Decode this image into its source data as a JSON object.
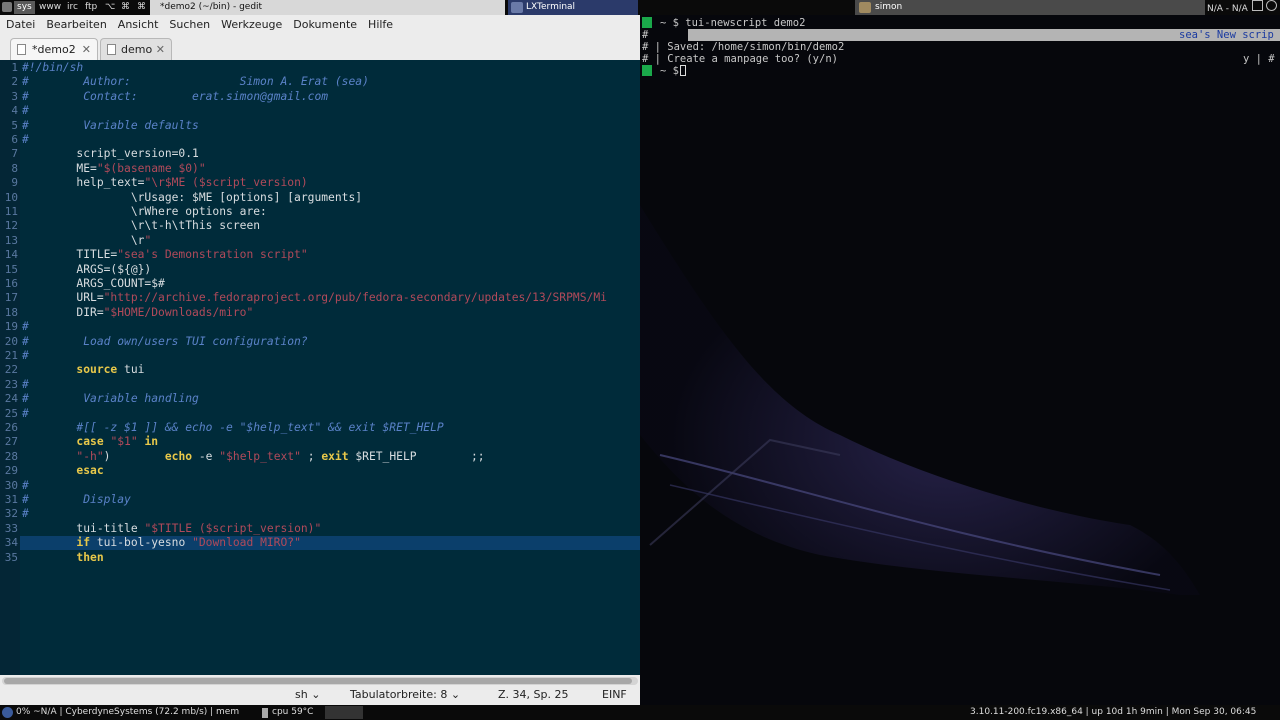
{
  "topbar": {
    "tags": [
      "sys",
      "www",
      "irc",
      "ftp",
      "⌥",
      "⌘",
      "⌘"
    ],
    "window1_title": "*demo2 (~/bin) - gedit",
    "window2_title": "LXTerminal",
    "window3_title": "simon",
    "right_status": "N/A - N/A"
  },
  "gedit": {
    "menu": [
      "Datei",
      "Bearbeiten",
      "Ansicht",
      "Suchen",
      "Werkzeuge",
      "Dokumente",
      "Hilfe"
    ],
    "tabs": [
      {
        "label": "*demo2",
        "active": true
      },
      {
        "label": "demo",
        "active": false
      }
    ],
    "line_numbers": [
      "1",
      "2",
      "3",
      "4",
      "5",
      "6",
      "7",
      "8",
      "9",
      "10",
      "11",
      "12",
      "13",
      "14",
      "15",
      "16",
      "17",
      "18",
      "19",
      "20",
      "21",
      "22",
      "23",
      "24",
      "25",
      "26",
      "27",
      "28",
      "29",
      "30",
      "31",
      "32",
      "33",
      "34",
      "35"
    ],
    "code_lines": [
      "#!/bin/sh",
      "#\tAuthor:\t\tSimon A. Erat (sea)",
      "#\tContact:\terat.simon@gmail.com",
      "#",
      "#\tVariable defaults",
      "#",
      "\tscript_version=0.1",
      "\tME=\"$(basename $0)\"",
      "\thelp_text=\"\\r$ME ($script_version)",
      "\t\t\\rUsage: $ME [options] [arguments]",
      "\t\t\\rWhere options are:",
      "\t\t\\r\\t-h\\tThis screen",
      "\t\t\\r\"",
      "\tTITLE=\"sea's Demonstration script\"",
      "\tARGS=(${@})",
      "\tARGS_COUNT=$#",
      "\tURL=\"http://archive.fedoraproject.org/pub/fedora-secondary/updates/13/SRPMS/Mi",
      "\tDIR=\"$HOME/Downloads/miro\"",
      "#",
      "#\tLoad own/users TUI configuration?",
      "#",
      "\tsource tui",
      "#",
      "#\tVariable handling",
      "#",
      "\t#[[ -z $1 ]] && echo -e \"$help_text\" && exit $RET_HELP",
      "\tcase \"$1\" in",
      "\t\"-h\")\techo -e \"$help_text\" ; exit $RET_HELP\t;;",
      "\tesac",
      "#",
      "#\tDisplay",
      "#",
      "\ttui-title \"$TITLE ($script_version)\"",
      "\tif tui-bol-yesno \"Download MIRO?\"",
      "\tthen"
    ],
    "current_line": 34,
    "status": {
      "language": "sh",
      "tab_width": "Tabulatorbreite: 8",
      "position": "Z. 34, Sp. 25",
      "mode": "EINF"
    }
  },
  "terminal": {
    "lines": [
      "~ $ tui-newscript demo2",
      "#",
      "# | Saved: /home/simon/bin/demo2",
      "# | Create a manpage too? (y/n)",
      "~ $ "
    ],
    "banner_title": "sea's New scrip",
    "prompt_answer": "y | #"
  },
  "bottombar": {
    "left": "0% ~N/A | CyberdyneSystems (72.2 mb/s) | mem",
    "cpu": "cpu 59°C",
    "right": "3.10.11-200.fc19.x86_64 | up 10d 1h 9min | Mon Sep 30, 06:45"
  },
  "colors": {
    "editor_bg": "#002b3a",
    "comment": "#5a82c8",
    "string": "#b04a5a",
    "keyword": "#e8c84a",
    "current_line": "#0b3f6b"
  }
}
